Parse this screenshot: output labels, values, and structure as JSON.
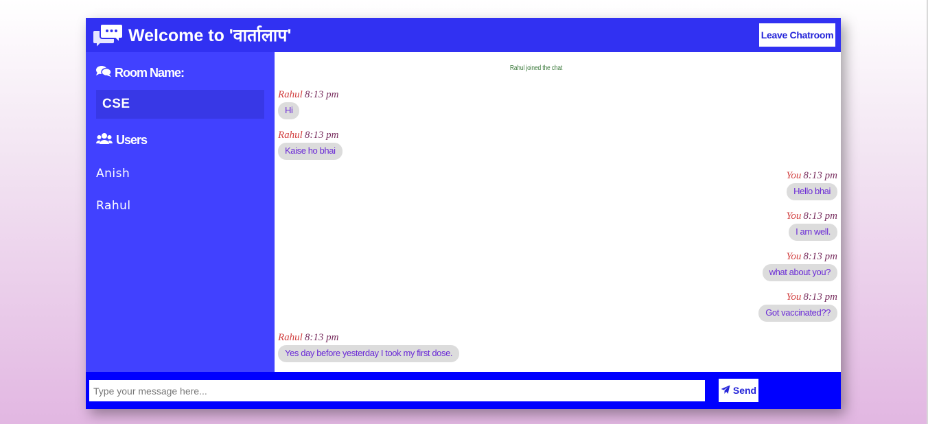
{
  "header": {
    "title": "Welcome to 'वार्तालाप'",
    "leave_label": "Leave Chatroom",
    "logo_icon": "chat-bubbles-icon"
  },
  "sidebar": {
    "room_heading": "Room Name:",
    "room_icon": "comments-icon",
    "room_name": "CSE",
    "users_heading": "Users",
    "users_icon": "users-icon",
    "users": [
      "Anish",
      "Rahul"
    ]
  },
  "messages": {
    "system": "Rahul joined the chat",
    "items": [
      {
        "sender": "Rahul",
        "time": "8:13 pm",
        "text": "Hi",
        "side": "left"
      },
      {
        "sender": "Rahul",
        "time": "8:13 pm",
        "text": "Kaise ho bhai",
        "side": "left"
      },
      {
        "sender": "You",
        "time": "8:13 pm",
        "text": "Hello bhai",
        "side": "right"
      },
      {
        "sender": "You",
        "time": "8:13 pm",
        "text": "I am well.",
        "side": "right"
      },
      {
        "sender": "You",
        "time": "8:13 pm",
        "text": "what about you?",
        "side": "right"
      },
      {
        "sender": "You",
        "time": "8:13 pm",
        "text": "Got vaccinated??",
        "side": "right"
      },
      {
        "sender": "Rahul",
        "time": "8:13 pm",
        "text": "Yes day before yesterday I took my first dose.",
        "side": "left"
      }
    ]
  },
  "form": {
    "placeholder": "Type your message here...",
    "value": "",
    "send_label": "Send",
    "send_icon": "paper-plane-icon"
  },
  "colors": {
    "header_bg": "#3131f2",
    "sidebar_bg": "#4141ff",
    "form_bg": "#0000ff",
    "bubble_bg": "#dcdcdc",
    "bubble_text": "#6a2ad6"
  }
}
